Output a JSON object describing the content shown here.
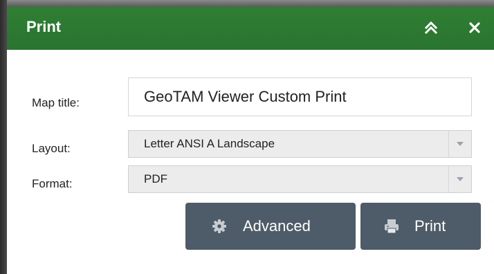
{
  "header": {
    "title": "Print",
    "collapse_icon": "double-chevron-up-icon",
    "close_icon": "close-icon",
    "color": "#2e7d32"
  },
  "form": {
    "map_title_label": "Map title:",
    "map_title_value": "GeoTAM Viewer Custom Print",
    "layout_label": "Layout:",
    "layout_value": "Letter ANSI A Landscape",
    "format_label": "Format:",
    "format_value": "PDF"
  },
  "buttons": {
    "advanced_label": "Advanced",
    "advanced_icon": "gear-icon",
    "print_label": "Print",
    "print_icon": "printer-icon",
    "color": "#4e5b68"
  }
}
